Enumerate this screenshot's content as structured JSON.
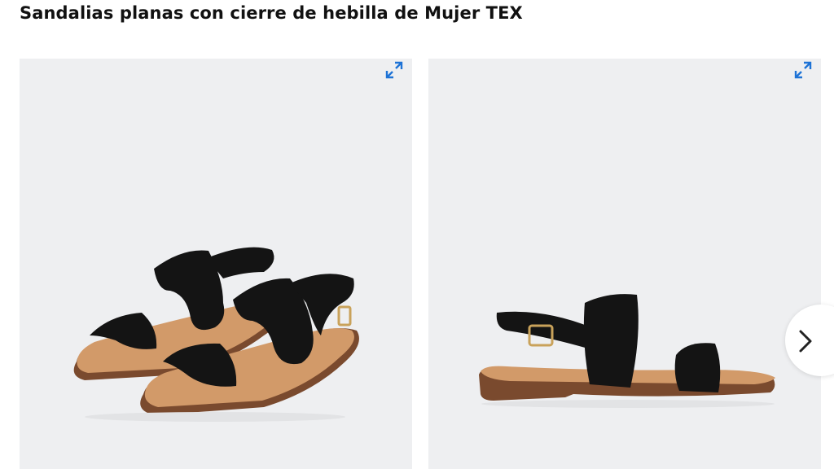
{
  "product": {
    "title": "Sandalias planas con cierre de hebilla de Mujer TEX"
  },
  "gallery": {
    "images": [
      {
        "description_icon": "sandal-pair-photo"
      },
      {
        "description_icon": "sandal-side-photo"
      }
    ],
    "expand_icon": "expand-icon",
    "next_icon": "chevron-right-icon"
  },
  "colors": {
    "image_bg": "#eeeff1",
    "accent": "#1e73d6",
    "strap": "#141414",
    "insole": "#cf9565",
    "sole": "#7a4a2e"
  }
}
